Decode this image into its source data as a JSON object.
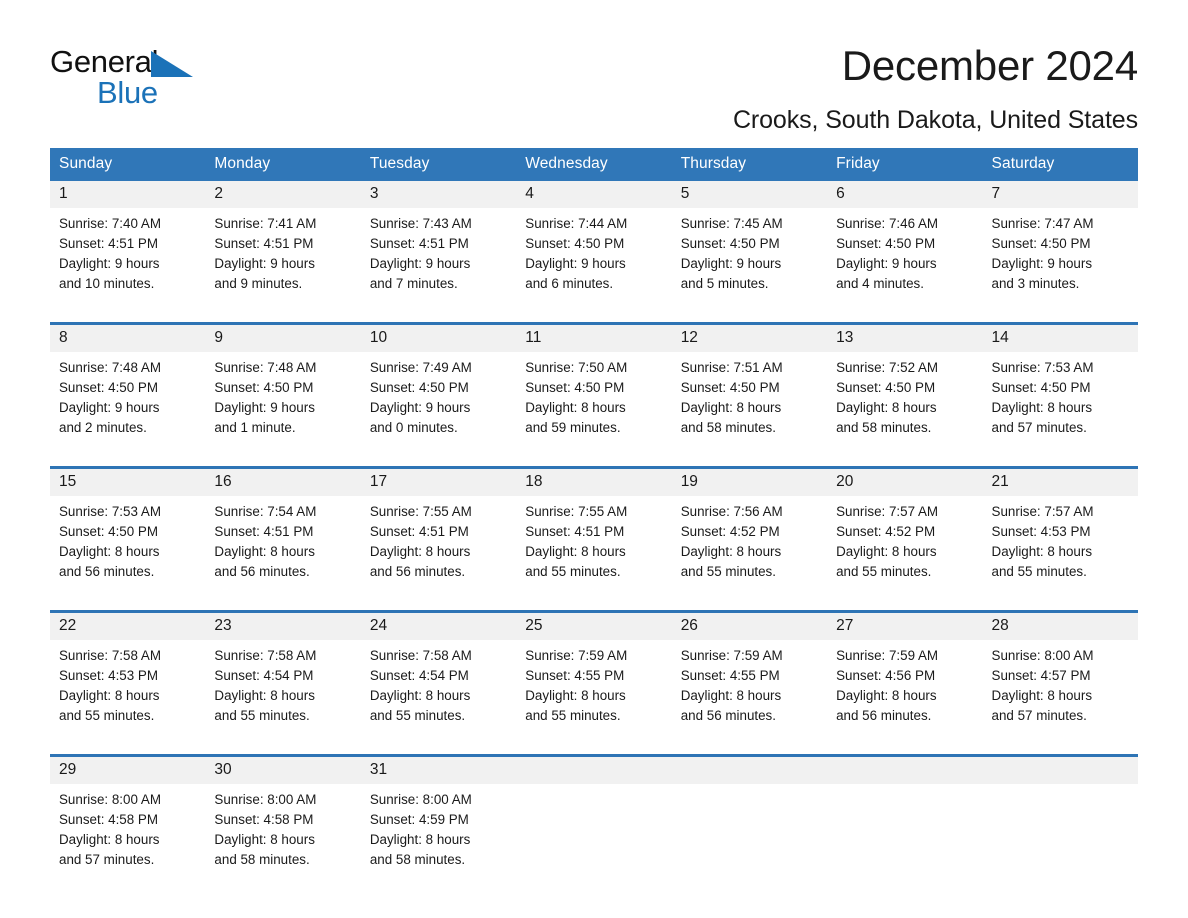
{
  "brand": {
    "word_one": "General",
    "word_two": "Blue",
    "accent_color": "#1b72b8"
  },
  "header": {
    "title": "December 2024",
    "location": "Crooks, South Dakota, United States"
  },
  "theme": {
    "header_blue": "#3077b8",
    "rule_blue": "#2e74b5",
    "daynum_band": "#f1f1f1"
  },
  "weekday_headers": [
    "Sunday",
    "Monday",
    "Tuesday",
    "Wednesday",
    "Thursday",
    "Friday",
    "Saturday"
  ],
  "weeks": [
    {
      "days": [
        {
          "date": "1",
          "sunrise": "Sunrise: 7:40 AM",
          "sunset": "Sunset: 4:51 PM",
          "daylight_line1": "Daylight: 9 hours",
          "daylight_line2": "and 10 minutes."
        },
        {
          "date": "2",
          "sunrise": "Sunrise: 7:41 AM",
          "sunset": "Sunset: 4:51 PM",
          "daylight_line1": "Daylight: 9 hours",
          "daylight_line2": "and 9 minutes."
        },
        {
          "date": "3",
          "sunrise": "Sunrise: 7:43 AM",
          "sunset": "Sunset: 4:51 PM",
          "daylight_line1": "Daylight: 9 hours",
          "daylight_line2": "and 7 minutes."
        },
        {
          "date": "4",
          "sunrise": "Sunrise: 7:44 AM",
          "sunset": "Sunset: 4:50 PM",
          "daylight_line1": "Daylight: 9 hours",
          "daylight_line2": "and 6 minutes."
        },
        {
          "date": "5",
          "sunrise": "Sunrise: 7:45 AM",
          "sunset": "Sunset: 4:50 PM",
          "daylight_line1": "Daylight: 9 hours",
          "daylight_line2": "and 5 minutes."
        },
        {
          "date": "6",
          "sunrise": "Sunrise: 7:46 AM",
          "sunset": "Sunset: 4:50 PM",
          "daylight_line1": "Daylight: 9 hours",
          "daylight_line2": "and 4 minutes."
        },
        {
          "date": "7",
          "sunrise": "Sunrise: 7:47 AM",
          "sunset": "Sunset: 4:50 PM",
          "daylight_line1": "Daylight: 9 hours",
          "daylight_line2": "and 3 minutes."
        }
      ]
    },
    {
      "days": [
        {
          "date": "8",
          "sunrise": "Sunrise: 7:48 AM",
          "sunset": "Sunset: 4:50 PM",
          "daylight_line1": "Daylight: 9 hours",
          "daylight_line2": "and 2 minutes."
        },
        {
          "date": "9",
          "sunrise": "Sunrise: 7:48 AM",
          "sunset": "Sunset: 4:50 PM",
          "daylight_line1": "Daylight: 9 hours",
          "daylight_line2": "and 1 minute."
        },
        {
          "date": "10",
          "sunrise": "Sunrise: 7:49 AM",
          "sunset": "Sunset: 4:50 PM",
          "daylight_line1": "Daylight: 9 hours",
          "daylight_line2": "and 0 minutes."
        },
        {
          "date": "11",
          "sunrise": "Sunrise: 7:50 AM",
          "sunset": "Sunset: 4:50 PM",
          "daylight_line1": "Daylight: 8 hours",
          "daylight_line2": "and 59 minutes."
        },
        {
          "date": "12",
          "sunrise": "Sunrise: 7:51 AM",
          "sunset": "Sunset: 4:50 PM",
          "daylight_line1": "Daylight: 8 hours",
          "daylight_line2": "and 58 minutes."
        },
        {
          "date": "13",
          "sunrise": "Sunrise: 7:52 AM",
          "sunset": "Sunset: 4:50 PM",
          "daylight_line1": "Daylight: 8 hours",
          "daylight_line2": "and 58 minutes."
        },
        {
          "date": "14",
          "sunrise": "Sunrise: 7:53 AM",
          "sunset": "Sunset: 4:50 PM",
          "daylight_line1": "Daylight: 8 hours",
          "daylight_line2": "and 57 minutes."
        }
      ]
    },
    {
      "days": [
        {
          "date": "15",
          "sunrise": "Sunrise: 7:53 AM",
          "sunset": "Sunset: 4:50 PM",
          "daylight_line1": "Daylight: 8 hours",
          "daylight_line2": "and 56 minutes."
        },
        {
          "date": "16",
          "sunrise": "Sunrise: 7:54 AM",
          "sunset": "Sunset: 4:51 PM",
          "daylight_line1": "Daylight: 8 hours",
          "daylight_line2": "and 56 minutes."
        },
        {
          "date": "17",
          "sunrise": "Sunrise: 7:55 AM",
          "sunset": "Sunset: 4:51 PM",
          "daylight_line1": "Daylight: 8 hours",
          "daylight_line2": "and 56 minutes."
        },
        {
          "date": "18",
          "sunrise": "Sunrise: 7:55 AM",
          "sunset": "Sunset: 4:51 PM",
          "daylight_line1": "Daylight: 8 hours",
          "daylight_line2": "and 55 minutes."
        },
        {
          "date": "19",
          "sunrise": "Sunrise: 7:56 AM",
          "sunset": "Sunset: 4:52 PM",
          "daylight_line1": "Daylight: 8 hours",
          "daylight_line2": "and 55 minutes."
        },
        {
          "date": "20",
          "sunrise": "Sunrise: 7:57 AM",
          "sunset": "Sunset: 4:52 PM",
          "daylight_line1": "Daylight: 8 hours",
          "daylight_line2": "and 55 minutes."
        },
        {
          "date": "21",
          "sunrise": "Sunrise: 7:57 AM",
          "sunset": "Sunset: 4:53 PM",
          "daylight_line1": "Daylight: 8 hours",
          "daylight_line2": "and 55 minutes."
        }
      ]
    },
    {
      "days": [
        {
          "date": "22",
          "sunrise": "Sunrise: 7:58 AM",
          "sunset": "Sunset: 4:53 PM",
          "daylight_line1": "Daylight: 8 hours",
          "daylight_line2": "and 55 minutes."
        },
        {
          "date": "23",
          "sunrise": "Sunrise: 7:58 AM",
          "sunset": "Sunset: 4:54 PM",
          "daylight_line1": "Daylight: 8 hours",
          "daylight_line2": "and 55 minutes."
        },
        {
          "date": "24",
          "sunrise": "Sunrise: 7:58 AM",
          "sunset": "Sunset: 4:54 PM",
          "daylight_line1": "Daylight: 8 hours",
          "daylight_line2": "and 55 minutes."
        },
        {
          "date": "25",
          "sunrise": "Sunrise: 7:59 AM",
          "sunset": "Sunset: 4:55 PM",
          "daylight_line1": "Daylight: 8 hours",
          "daylight_line2": "and 55 minutes."
        },
        {
          "date": "26",
          "sunrise": "Sunrise: 7:59 AM",
          "sunset": "Sunset: 4:55 PM",
          "daylight_line1": "Daylight: 8 hours",
          "daylight_line2": "and 56 minutes."
        },
        {
          "date": "27",
          "sunrise": "Sunrise: 7:59 AM",
          "sunset": "Sunset: 4:56 PM",
          "daylight_line1": "Daylight: 8 hours",
          "daylight_line2": "and 56 minutes."
        },
        {
          "date": "28",
          "sunrise": "Sunrise: 8:00 AM",
          "sunset": "Sunset: 4:57 PM",
          "daylight_line1": "Daylight: 8 hours",
          "daylight_line2": "and 57 minutes."
        }
      ]
    },
    {
      "days": [
        {
          "date": "29",
          "sunrise": "Sunrise: 8:00 AM",
          "sunset": "Sunset: 4:58 PM",
          "daylight_line1": "Daylight: 8 hours",
          "daylight_line2": "and 57 minutes."
        },
        {
          "date": "30",
          "sunrise": "Sunrise: 8:00 AM",
          "sunset": "Sunset: 4:58 PM",
          "daylight_line1": "Daylight: 8 hours",
          "daylight_line2": "and 58 minutes."
        },
        {
          "date": "31",
          "sunrise": "Sunrise: 8:00 AM",
          "sunset": "Sunset: 4:59 PM",
          "daylight_line1": "Daylight: 8 hours",
          "daylight_line2": "and 58 minutes."
        },
        {
          "date": "",
          "sunrise": "",
          "sunset": "",
          "daylight_line1": "",
          "daylight_line2": ""
        },
        {
          "date": "",
          "sunrise": "",
          "sunset": "",
          "daylight_line1": "",
          "daylight_line2": ""
        },
        {
          "date": "",
          "sunrise": "",
          "sunset": "",
          "daylight_line1": "",
          "daylight_line2": ""
        },
        {
          "date": "",
          "sunrise": "",
          "sunset": "",
          "daylight_line1": "",
          "daylight_line2": ""
        }
      ]
    }
  ]
}
